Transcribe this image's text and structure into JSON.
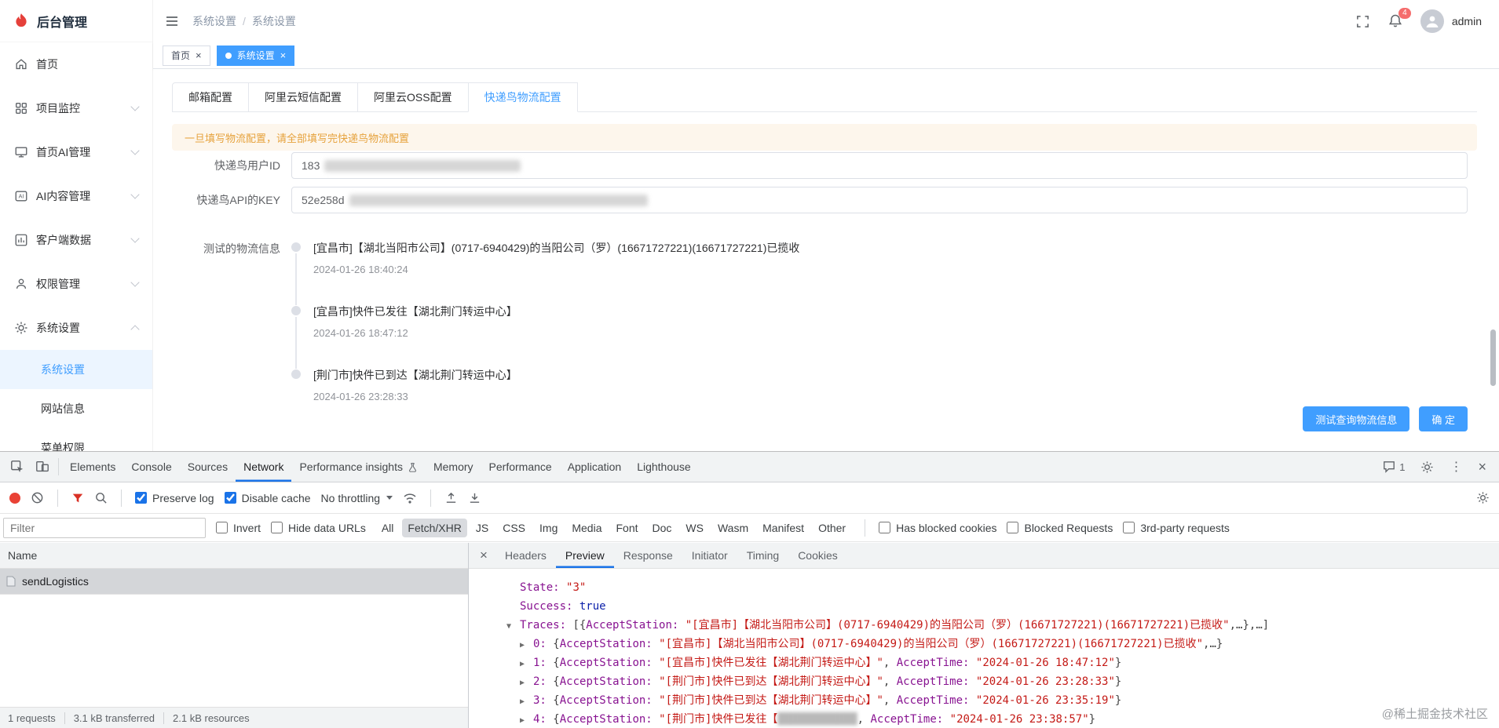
{
  "app": {
    "logo": {
      "title": "后台管理"
    },
    "header": {
      "breadcrumbs": [
        "系统设置",
        "系统设置"
      ],
      "separator": "/",
      "badge": "4",
      "username": "admin"
    },
    "tags": [
      {
        "label": "首页"
      },
      {
        "label": "系统设置"
      }
    ],
    "sidebar": {
      "items": [
        {
          "label": "首页"
        },
        {
          "label": "项目监控"
        },
        {
          "label": "首页AI管理"
        },
        {
          "label": "AI内容管理"
        },
        {
          "label": "客户端数据"
        },
        {
          "label": "权限管理"
        },
        {
          "label": "系统设置"
        }
      ],
      "subitems": [
        {
          "label": "系统设置"
        },
        {
          "label": "网站信息"
        },
        {
          "label": "菜单权限"
        }
      ]
    },
    "tabs": [
      {
        "label": "邮箱配置"
      },
      {
        "label": "阿里云短信配置"
      },
      {
        "label": "阿里云OSS配置"
      },
      {
        "label": "快递鸟物流配置"
      }
    ],
    "alert": "一旦填写物流配置，请全部填写完快递鸟物流配置",
    "form": {
      "user_id_label": "快递鸟用户ID",
      "user_id_value": "183",
      "api_key_label": "快递鸟API的KEY",
      "api_key_value": "52e258d",
      "logistics_label": "测试的物流信息",
      "timeline": [
        {
          "text": "[宜昌市]【湖北当阳市公司】(0717-6940429)的当阳公司（罗）(16671727221)(16671727221)已揽收",
          "time": "2024-01-26 18:40:24"
        },
        {
          "text": "[宜昌市]快件已发往【湖北荆门转运中心】",
          "time": "2024-01-26 18:47:12"
        },
        {
          "text": "[荆门市]快件已到达【湖北荆门转运中心】",
          "time": "2024-01-26 23:28:33"
        }
      ],
      "test_button": "测试查询物流信息",
      "confirm_button": "确 定"
    }
  },
  "devtools": {
    "tabs": [
      {
        "label": "Elements"
      },
      {
        "label": "Console"
      },
      {
        "label": "Sources"
      },
      {
        "label": "Network"
      },
      {
        "label": "Performance insights"
      },
      {
        "label": "Memory"
      },
      {
        "label": "Performance"
      },
      {
        "label": "Application"
      },
      {
        "label": "Lighthouse"
      }
    ],
    "issues_count": "1",
    "network_toolbar": {
      "preserve_log": "Preserve log",
      "disable_cache": "Disable cache",
      "throttling": "No throttling"
    },
    "filter_bar": {
      "placeholder": "Filter",
      "invert": "Invert",
      "hide_data": "Hide data URLs",
      "types": [
        "All",
        "Fetch/XHR",
        "JS",
        "CSS",
        "Img",
        "Media",
        "Font",
        "Doc",
        "WS",
        "Wasm",
        "Manifest",
        "Other"
      ],
      "active_type": "Fetch/XHR",
      "has_blocked_cookies": "Has blocked cookies",
      "blocked_requests": "Blocked Requests",
      "third_party": "3rd-party requests"
    },
    "request_list": {
      "name_header": "Name",
      "rows": [
        {
          "name": "sendLogistics"
        }
      ]
    },
    "detail_tabs": [
      {
        "label": "Headers"
      },
      {
        "label": "Preview"
      },
      {
        "label": "Response"
      },
      {
        "label": "Initiator"
      },
      {
        "label": "Timing"
      },
      {
        "label": "Cookies"
      }
    ],
    "preview_lines": [
      {
        "level": 0,
        "arrow": "",
        "segs": [
          {
            "t": "key",
            "v": "State: "
          },
          {
            "t": "str",
            "v": "\"3\""
          }
        ]
      },
      {
        "level": 0,
        "arrow": "",
        "segs": [
          {
            "t": "key",
            "v": "Success: "
          },
          {
            "t": "bool",
            "v": "true"
          }
        ]
      },
      {
        "level": 0,
        "arrow": "▼",
        "segs": [
          {
            "t": "key",
            "v": "Traces: "
          },
          {
            "t": "plain",
            "v": "[{"
          },
          {
            "t": "key",
            "v": "AcceptStation: "
          },
          {
            "t": "str",
            "v": "\"[宜昌市]【湖北当阳市公司】(0717-6940429)的当阳公司（罗）(16671727221)(16671727221)已揽收\""
          },
          {
            "t": "plain",
            "v": ",…},…]"
          }
        ]
      },
      {
        "level": 1,
        "arrow": "▶",
        "segs": [
          {
            "t": "key",
            "v": "0: "
          },
          {
            "t": "plain",
            "v": "{"
          },
          {
            "t": "key",
            "v": "AcceptStation: "
          },
          {
            "t": "str",
            "v": "\"[宜昌市]【湖北当阳市公司】(0717-6940429)的当阳公司（罗）(16671727221)(16671727221)已揽收\""
          },
          {
            "t": "plain",
            "v": ",…}"
          }
        ]
      },
      {
        "level": 1,
        "arrow": "▶",
        "segs": [
          {
            "t": "key",
            "v": "1: "
          },
          {
            "t": "plain",
            "v": "{"
          },
          {
            "t": "key",
            "v": "AcceptStation: "
          },
          {
            "t": "str",
            "v": "\"[宜昌市]快件已发往【湖北荆门转运中心】\""
          },
          {
            "t": "plain",
            "v": ", "
          },
          {
            "t": "key",
            "v": "AcceptTime: "
          },
          {
            "t": "str",
            "v": "\"2024-01-26 18:47:12\""
          },
          {
            "t": "plain",
            "v": "}"
          }
        ]
      },
      {
        "level": 1,
        "arrow": "▶",
        "segs": [
          {
            "t": "key",
            "v": "2: "
          },
          {
            "t": "plain",
            "v": "{"
          },
          {
            "t": "key",
            "v": "AcceptStation: "
          },
          {
            "t": "str",
            "v": "\"[荆门市]快件已到达【湖北荆门转运中心】\""
          },
          {
            "t": "plain",
            "v": ", "
          },
          {
            "t": "key",
            "v": "AcceptTime: "
          },
          {
            "t": "str",
            "v": "\"2024-01-26 23:28:33\""
          },
          {
            "t": "plain",
            "v": "}"
          }
        ]
      },
      {
        "level": 1,
        "arrow": "▶",
        "segs": [
          {
            "t": "key",
            "v": "3: "
          },
          {
            "t": "plain",
            "v": "{"
          },
          {
            "t": "key",
            "v": "AcceptStation: "
          },
          {
            "t": "str",
            "v": "\"[荆门市]快件已到达【湖北荆门转运中心】\""
          },
          {
            "t": "plain",
            "v": ", "
          },
          {
            "t": "key",
            "v": "AcceptTime: "
          },
          {
            "t": "str",
            "v": "\"2024-01-26 23:35:19\""
          },
          {
            "t": "plain",
            "v": "}"
          }
        ]
      },
      {
        "level": 1,
        "arrow": "▶",
        "segs": [
          {
            "t": "key",
            "v": "4: "
          },
          {
            "t": "plain",
            "v": "{"
          },
          {
            "t": "key",
            "v": "AcceptStation: "
          },
          {
            "t": "str",
            "v": "\"[荆门市]快件已发往【"
          },
          {
            "t": "redact",
            "v": "████████████"
          },
          {
            "t": "plain",
            "v": ", "
          },
          {
            "t": "key",
            "v": "AcceptTime: "
          },
          {
            "t": "str",
            "v": "\"2024-01-26 23:38:57\""
          },
          {
            "t": "plain",
            "v": "}"
          }
        ]
      }
    ],
    "summary": [
      "1 requests",
      "3.1 kB transferred",
      "2.1 kB resources"
    ]
  },
  "watermark": "@稀土掘金技术社区",
  "icons": {
    "close": "×",
    "kebab": "⋮",
    "tag_close": "×"
  }
}
